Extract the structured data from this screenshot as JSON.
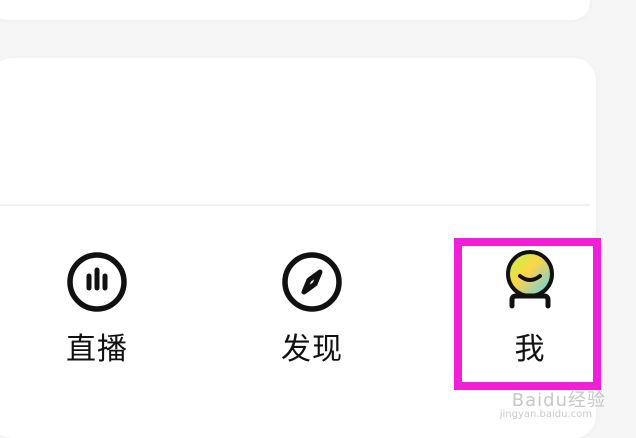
{
  "tabs": [
    {
      "label": "直播"
    },
    {
      "label": "发现"
    },
    {
      "label": "我"
    }
  ],
  "icons": {
    "live": "live-icon",
    "discover": "compass-icon",
    "me": "avatar-icon"
  },
  "colors": {
    "highlight": "#f21fd8",
    "avatar_gradient_start": "#b4ff3a",
    "avatar_gradient_mid": "#ffd34d",
    "avatar_gradient_end": "#4bd0ff",
    "ink": "#111111"
  },
  "watermark": {
    "text": "Baidu经验",
    "subtext": "jingyan.baidu.com"
  }
}
